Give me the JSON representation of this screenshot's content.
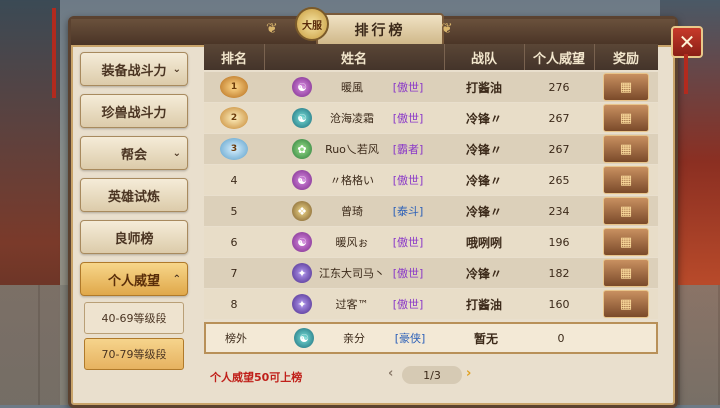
{
  "title": "排行榜",
  "title_emblem": "大服",
  "close_label": "✕",
  "sidebar": {
    "items": [
      {
        "label": "装备战斗力",
        "arrow": "⌄"
      },
      {
        "label": "珍兽战斗力",
        "arrow": ""
      },
      {
        "label": "帮会",
        "arrow": "⌄"
      },
      {
        "label": "英雄试炼",
        "arrow": ""
      },
      {
        "label": "良师榜",
        "arrow": ""
      },
      {
        "label": "个人威望",
        "arrow": "⌃"
      }
    ],
    "subitems": [
      {
        "label": "40-69等级段"
      },
      {
        "label": "70-79等级段"
      }
    ]
  },
  "table": {
    "headers": [
      "排名",
      "姓名",
      "战队",
      "个人威望",
      "奖励"
    ],
    "rows": [
      {
        "rank": "1",
        "icon": "☯",
        "icon_color": "purple",
        "name": "暖風",
        "tag": "[傲世]",
        "tag_color": "purple",
        "team": "打酱油",
        "score": "276"
      },
      {
        "rank": "2",
        "icon": "☯",
        "icon_color": "teal",
        "name": "沧海凌霜",
        "tag": "[傲世]",
        "tag_color": "purple",
        "team": "冷锋〃",
        "score": "267"
      },
      {
        "rank": "3",
        "icon": "✿",
        "icon_color": "green",
        "name": "Ruo乀若风",
        "tag": "[霸者]",
        "tag_color": "purple",
        "team": "冷锋〃",
        "score": "267"
      },
      {
        "rank": "4",
        "icon": "☯",
        "icon_color": "purple",
        "name": "〃格格い",
        "tag": "[傲世]",
        "tag_color": "purple",
        "team": "冷锋〃",
        "score": "265"
      },
      {
        "rank": "5",
        "icon": "❖",
        "icon_color": "gold",
        "name": "曾琦",
        "tag": "[泰斗]",
        "tag_color": "blue",
        "team": "冷锋〃",
        "score": "234"
      },
      {
        "rank": "6",
        "icon": "☯",
        "icon_color": "purple",
        "name": "暖风ぉ",
        "tag": "[傲世]",
        "tag_color": "purple",
        "team": "哦咧咧",
        "score": "196"
      },
      {
        "rank": "7",
        "icon": "✦",
        "icon_color": "violet",
        "name": "江东大司马丶",
        "tag": "[傲世]",
        "tag_color": "purple",
        "team": "冷锋〃",
        "score": "182"
      },
      {
        "rank": "8",
        "icon": "✦",
        "icon_color": "violet",
        "name": "过客™",
        "tag": "[傲世]",
        "tag_color": "purple",
        "team": "打酱油",
        "score": "160"
      }
    ],
    "self_row": {
      "rank": "榜外",
      "icon": "☯",
      "icon_color": "teal",
      "name": "亲分",
      "tag": "[豪侠]",
      "tag_color": "blue",
      "team": "暂无",
      "score": "0"
    }
  },
  "footer": {
    "note": "个人威望50可上榜",
    "page": "1/3",
    "prev": "‹",
    "next": "›"
  },
  "colors": {
    "accent_red": "#c0201a",
    "tag_purple": "#8a38c8",
    "tag_blue": "#2a5fb8"
  }
}
